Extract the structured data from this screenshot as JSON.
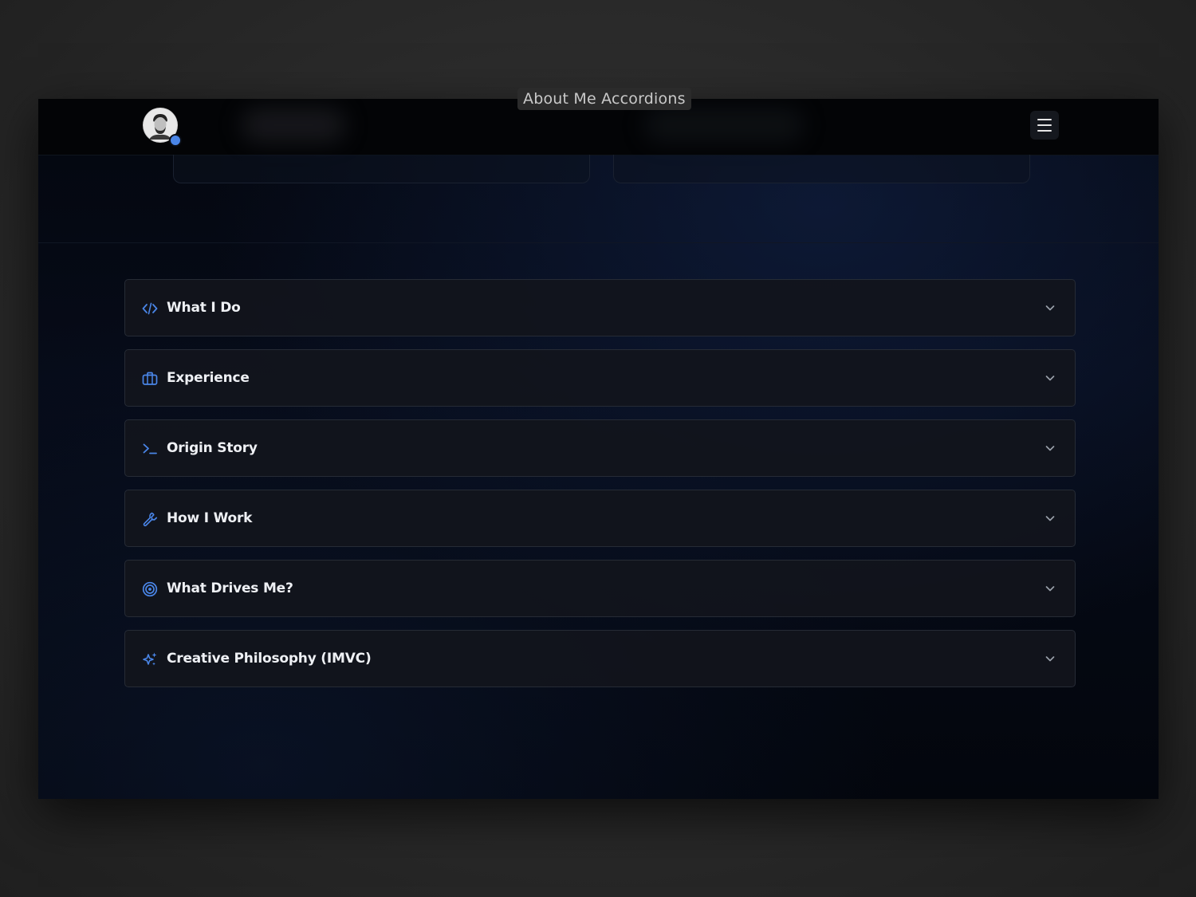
{
  "caption": "About Me Accordions",
  "colors": {
    "accent": "#4a86e8",
    "background": "#04070f",
    "panel": "#12151c",
    "border": "#262b35",
    "text": "#eef0f4"
  },
  "header": {
    "avatar_icon": "avatar",
    "menu_icon": "hamburger-menu-icon"
  },
  "accordions": [
    {
      "title": "What I Do",
      "icon": "code-icon",
      "expanded": false
    },
    {
      "title": "Experience",
      "icon": "briefcase-icon",
      "expanded": false
    },
    {
      "title": "Origin Story",
      "icon": "terminal-icon",
      "expanded": false
    },
    {
      "title": "How I Work",
      "icon": "wrench-icon",
      "expanded": false
    },
    {
      "title": "What Drives Me?",
      "icon": "target-icon",
      "expanded": false
    },
    {
      "title": "Creative Philosophy (IMVC)",
      "icon": "sparkles-icon",
      "expanded": false
    }
  ]
}
